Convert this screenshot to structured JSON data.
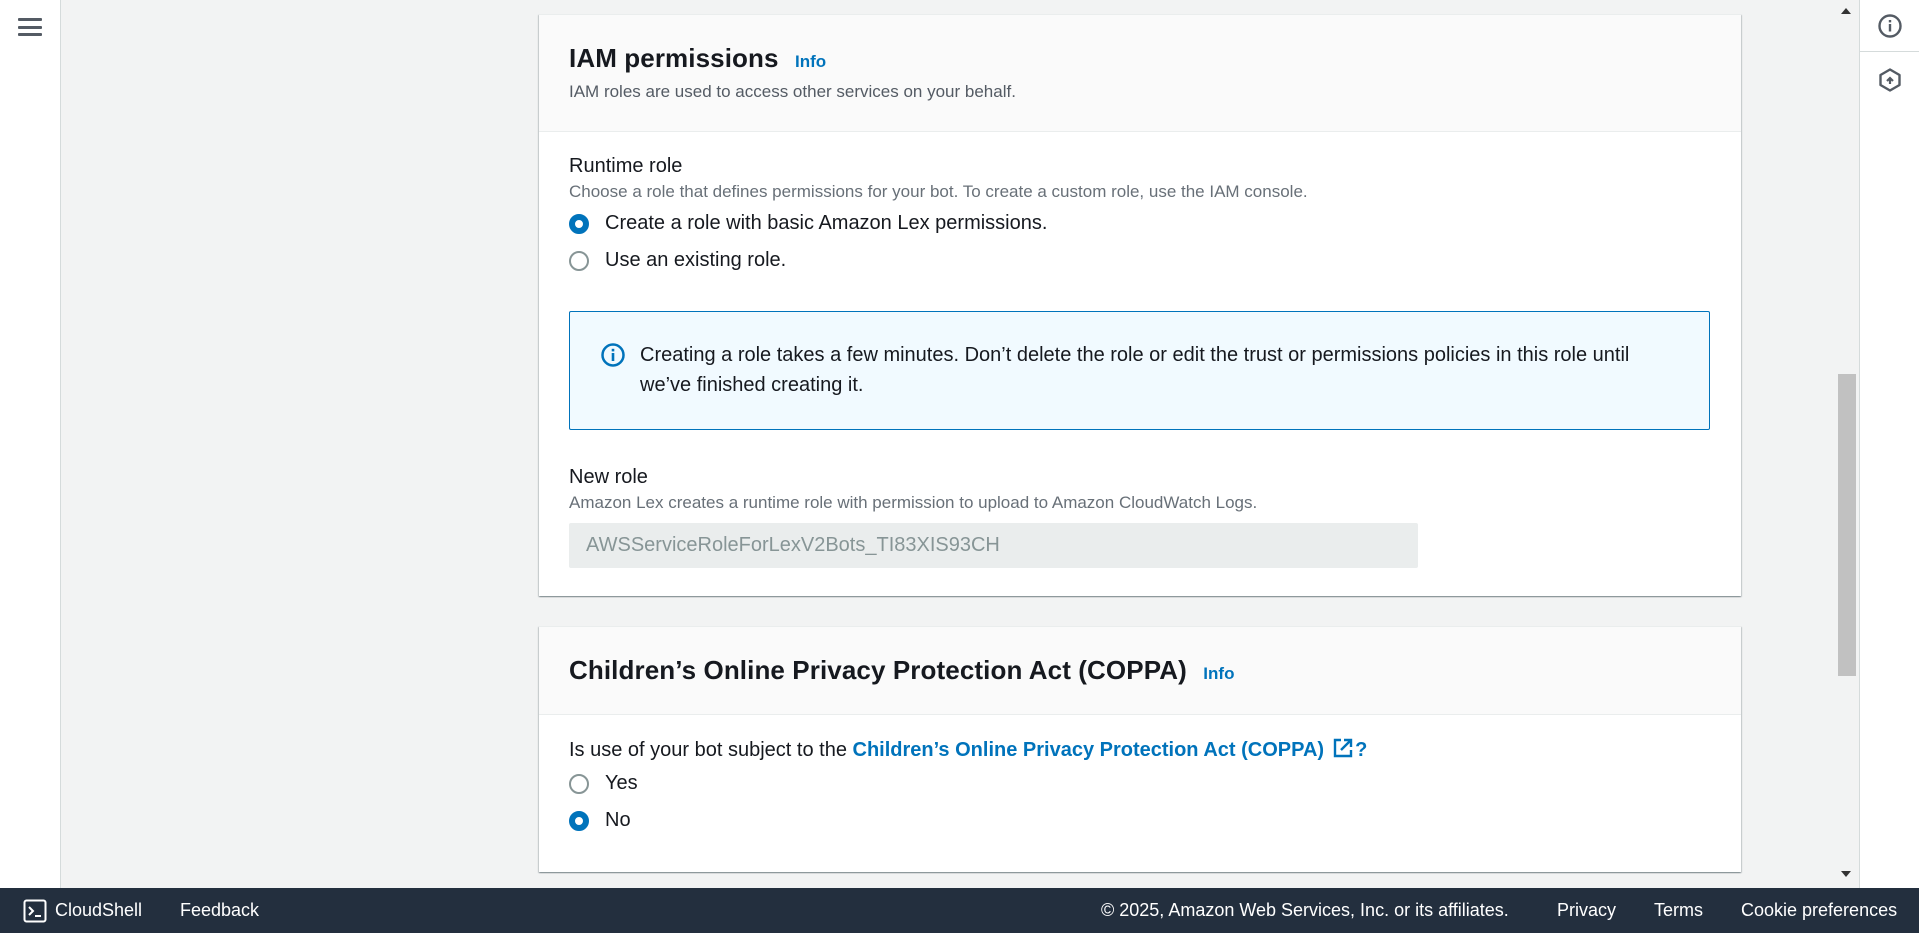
{
  "iam": {
    "title": "IAM permissions",
    "info": "Info",
    "description": "IAM roles are used to access other services on your behalf.",
    "runtime_role": {
      "label": "Runtime role",
      "description": "Choose a role that defines permissions for your bot. To create a custom role, use the IAM console.",
      "options": [
        {
          "label": "Create a role with basic Amazon Lex permissions.",
          "selected": true
        },
        {
          "label": "Use an existing role.",
          "selected": false
        }
      ]
    },
    "alert_text": "Creating a role takes a few minutes. Don’t delete the role or edit the trust or permissions policies in this role until we’ve finished creating it.",
    "new_role": {
      "label": "New role",
      "description": "Amazon Lex creates a runtime role with permission to upload to Amazon CloudWatch Logs.",
      "value": "AWSServiceRoleForLexV2Bots_TI83XIS93CH"
    }
  },
  "coppa": {
    "title": "Children’s Online Privacy Protection Act (COPPA)",
    "info": "Info",
    "question_prefix": "Is use of your bot subject to the ",
    "question_link": "Children’s Online Privacy Protection Act (COPPA)",
    "question_suffix": "?",
    "options": [
      {
        "label": "Yes",
        "selected": false
      },
      {
        "label": "No",
        "selected": true
      }
    ]
  },
  "footer": {
    "cloudshell": "CloudShell",
    "feedback": "Feedback",
    "copyright": "© 2025, Amazon Web Services, Inc. or its affiliates.",
    "privacy": "Privacy",
    "terms": "Terms",
    "cookie": "Cookie preferences"
  },
  "icons": {
    "menu": "hamburger-menu-icon",
    "info_panel": "info-circle-icon",
    "side_panel_2": "hexagon-icon",
    "alert": "info-circle-icon",
    "external": "external-link-icon",
    "cloudshell": "terminal-icon"
  },
  "colors": {
    "accent": "#0073bb",
    "footer_bg": "#232f3e",
    "alert_bg": "#f1faff"
  }
}
